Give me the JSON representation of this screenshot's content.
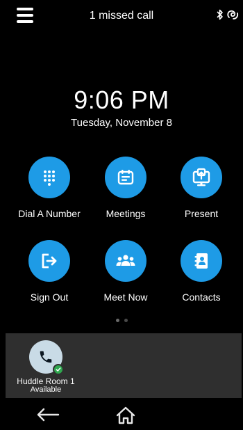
{
  "header": {
    "notification": "1 missed call",
    "icons": [
      "menu-icon",
      "bluetooth-icon",
      "proximity-icon"
    ]
  },
  "clock": {
    "time": "9:06 PM",
    "date": "Tuesday, November 8"
  },
  "tiles": [
    {
      "label": "Dial A Number",
      "icon": "dialpad-icon"
    },
    {
      "label": "Meetings",
      "icon": "calendar-icon"
    },
    {
      "label": "Present",
      "icon": "present-icon"
    },
    {
      "label": "Sign Out",
      "icon": "sign-out-icon"
    },
    {
      "label": "Meet Now",
      "icon": "group-icon"
    },
    {
      "label": "Contacts",
      "icon": "contacts-icon"
    }
  ],
  "pager": {
    "pages": 2,
    "current": 1
  },
  "device": {
    "name": "Huddle Room 1",
    "status": "Available",
    "icon": "phone-icon",
    "presence_color": "#2fa84f"
  },
  "nav": {
    "icons": [
      "back-arrow-icon",
      "home-icon"
    ]
  },
  "colors": {
    "accent": "#1e9be6",
    "background": "#000000",
    "tray": "#2f2f2f",
    "available": "#2fa84f"
  }
}
